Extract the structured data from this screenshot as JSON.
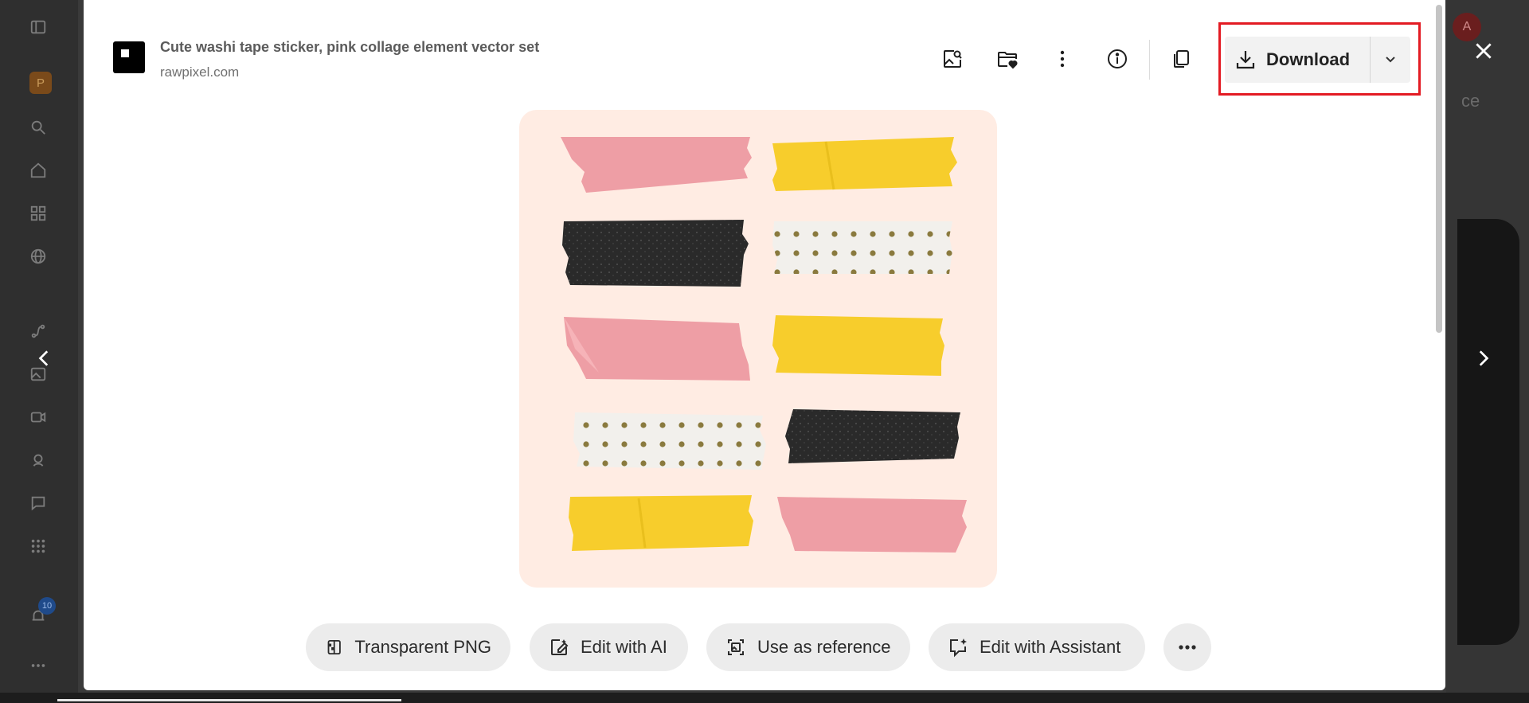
{
  "background": {
    "brand_initial": "P",
    "notification_count": "10",
    "avatar_initial": "A",
    "partial_text": "ce",
    "sidebar_icons": [
      "sidebar-toggle-icon",
      "search-icon",
      "home-icon",
      "grid-icon",
      "globe-icon",
      "path-icon",
      "image-icon",
      "video-icon",
      "voice-icon",
      "chat-icon",
      "apps-icon",
      "bell-icon",
      "more-icon"
    ]
  },
  "modal": {
    "title": "Cute washi tape sticker, pink collage element vector set",
    "source": "rawpixel.com",
    "toolbar": {
      "icons": [
        "image-search-icon",
        "save-to-folder-icon",
        "more-vertical-icon",
        "info-icon",
        "copy-icon"
      ]
    },
    "download": {
      "label": "Download",
      "caret_icon": "chevron-down-icon"
    },
    "highlight_color": "#e31b23",
    "preview": {
      "background": "#ffece3",
      "tape_colors": {
        "pink": "#ee9ea5",
        "yellow": "#f7cd2c",
        "black": "#2a2a2a",
        "dots": "#f2f0ec"
      }
    },
    "actions": [
      {
        "label": "Transparent PNG",
        "icon": "transparent-png-icon"
      },
      {
        "label": "Edit with AI",
        "icon": "edit-ai-icon"
      },
      {
        "label": "Use as reference",
        "icon": "reference-icon"
      },
      {
        "label": "Edit with Assistant",
        "icon": "assistant-icon"
      }
    ],
    "more_actions_icon": "more-horizontal-icon"
  }
}
